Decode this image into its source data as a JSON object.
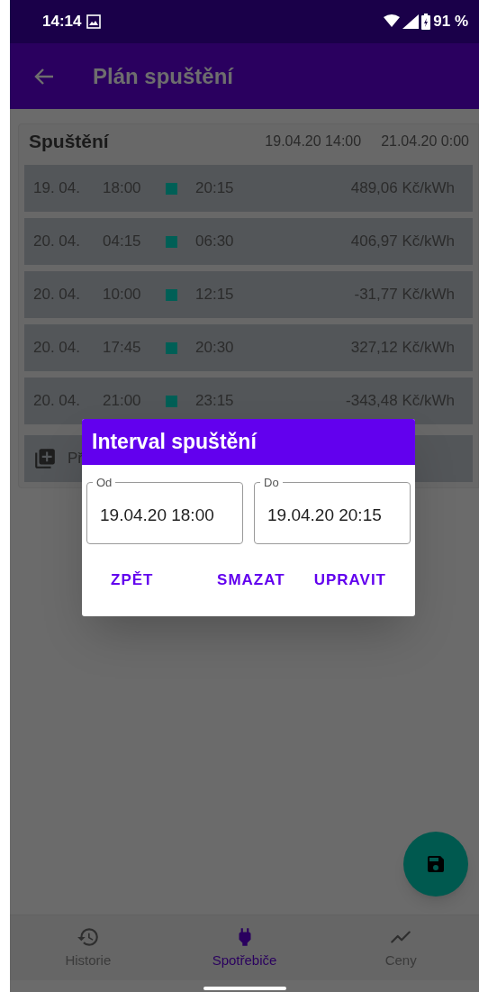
{
  "status_bar": {
    "time": "14:14",
    "battery": "91 %"
  },
  "app_bar": {
    "title": "Plán spuštění"
  },
  "card": {
    "title": "Spuštění",
    "range_start": "19.04.20 14:00",
    "range_end": "21.04.20 0:00",
    "rows": [
      {
        "date": "19. 04.",
        "start": "18:00",
        "end": "20:15",
        "price": "489,06 Kč/kWh"
      },
      {
        "date": "20. 04.",
        "start": "04:15",
        "end": "06:30",
        "price": "406,97 Kč/kWh"
      },
      {
        "date": "20. 04.",
        "start": "10:00",
        "end": "12:15",
        "price": "-31,77 Kč/kWh"
      },
      {
        "date": "20. 04.",
        "start": "17:45",
        "end": "20:30",
        "price": "327,12 Kč/kWh"
      },
      {
        "date": "20. 04.",
        "start": "21:00",
        "end": "23:15",
        "price": "-343,48 Kč/kWh"
      }
    ],
    "add_row": {
      "label": "Př"
    }
  },
  "dialog": {
    "title": "Interval spuštění",
    "fields": [
      {
        "label": "Od",
        "value": "19.04.20 18:00"
      },
      {
        "label": "Do",
        "value": "19.04.20 20:15"
      }
    ],
    "buttons": [
      "ZPĚT",
      "SMAZAT",
      "UPRAVIT"
    ]
  },
  "bottom_nav": [
    {
      "kind": "history",
      "label": "Historie",
      "selected": false
    },
    {
      "kind": "plug",
      "label": "Spotřebiče",
      "selected": true
    },
    {
      "kind": "chart",
      "label": "Ceny",
      "selected": false
    }
  ]
}
